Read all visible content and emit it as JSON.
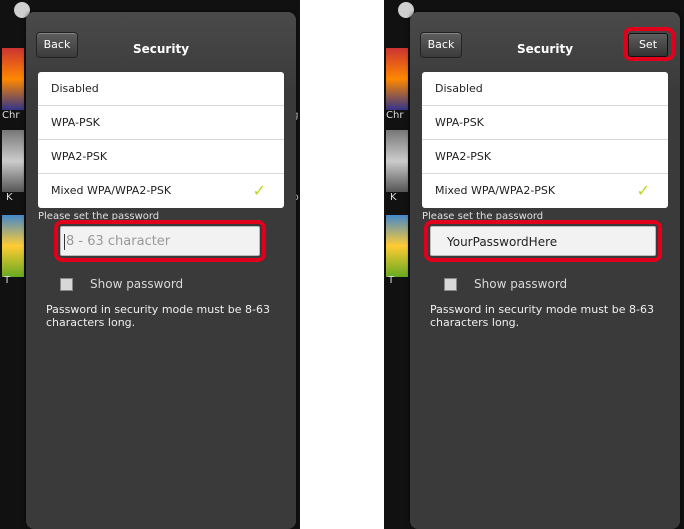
{
  "colors": {
    "highlight": "#e0001b",
    "check": "#b5d628",
    "dialog_bg": "#3a3a3a"
  },
  "left": {
    "header": {
      "back_label": "Back",
      "title": "Security"
    },
    "security_options": [
      {
        "label": "Disabled",
        "selected": false
      },
      {
        "label": "WPA-PSK",
        "selected": false
      },
      {
        "label": "WPA2-PSK",
        "selected": false
      },
      {
        "label": "Mixed WPA/WPA2-PSK",
        "selected": true
      }
    ],
    "password_label": "Please set the password",
    "password_placeholder": "8 - 63 character",
    "password_value": "",
    "show_password_label": "Show password",
    "show_password_checked": false,
    "hint": "Password in security mode must be 8-63 characters long.",
    "background_labels": [
      "Chr",
      "K",
      "T",
      "og",
      "db"
    ]
  },
  "right": {
    "header": {
      "back_label": "Back",
      "title": "Security",
      "set_label": "Set"
    },
    "security_options": [
      {
        "label": "Disabled",
        "selected": false
      },
      {
        "label": "WPA-PSK",
        "selected": false
      },
      {
        "label": "WPA2-PSK",
        "selected": false
      },
      {
        "label": "Mixed WPA/WPA2-PSK",
        "selected": true
      }
    ],
    "password_label": "Please set the password",
    "password_value": "YourPasswordHere",
    "show_password_label": "Show password",
    "show_password_checked": false,
    "hint": "Password in security mode must be 8-63 characters long.",
    "background_labels": [
      "Chr",
      "K",
      "T"
    ]
  }
}
